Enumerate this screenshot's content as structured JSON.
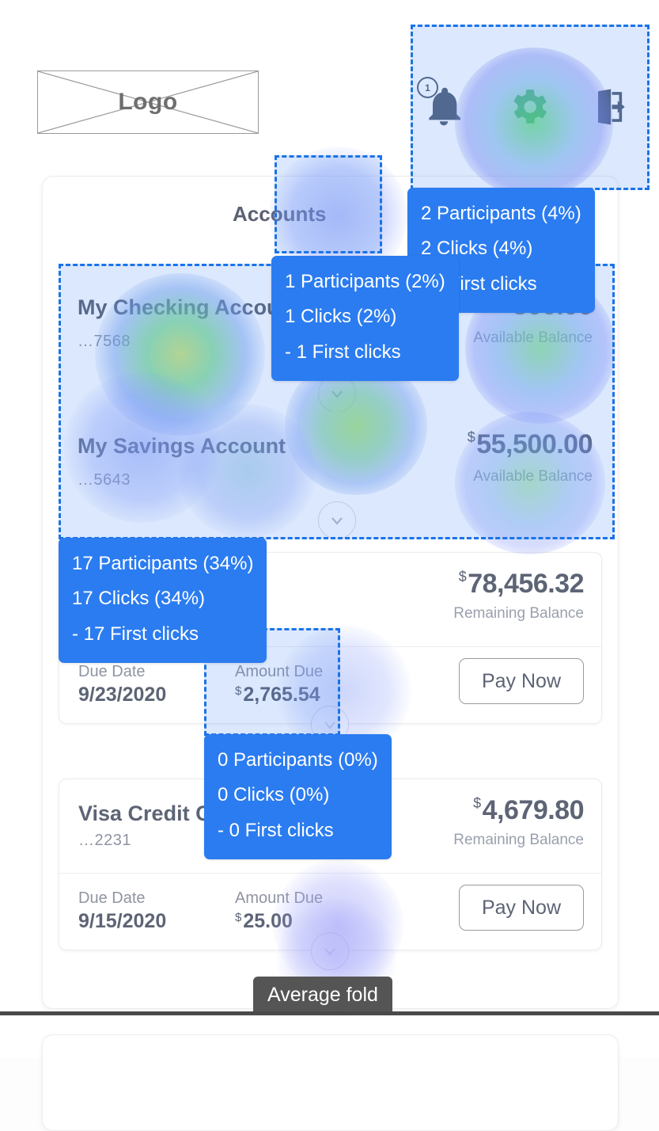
{
  "header": {
    "logo_label": "Logo",
    "icons": [
      {
        "name": "notification-bell-icon",
        "badge": "1"
      },
      {
        "name": "settings-gear-icon",
        "badge": ""
      },
      {
        "name": "logout-icon",
        "badge": ""
      }
    ]
  },
  "main": {
    "section_title": "Accounts",
    "accounts": [
      {
        "name": "My Checking Account",
        "number": "…7568",
        "currency": "$",
        "amount": "500.00",
        "sub_label": "Available Balance"
      },
      {
        "name": "My Savings Account",
        "number": "…5643",
        "currency": "$",
        "amount": "55,500.00",
        "sub_label": "Available Balance"
      }
    ],
    "cards": [
      {
        "name": "",
        "number": "",
        "currency": "$",
        "balance": "78,456.32",
        "balance_label": "Remaining Balance",
        "due_date_label": "Due Date",
        "due_date": "9/23/2020",
        "amount_due_label": "Amount Due",
        "amount_due_currency": "$",
        "amount_due": "2,765.54",
        "pay_label": "Pay Now"
      },
      {
        "name": "Visa Credit Card",
        "number": "…2231",
        "currency": "$",
        "balance": "4,679.80",
        "balance_label": "Remaining Balance",
        "due_date_label": "Due Date",
        "due_date": "9/15/2020",
        "amount_due_label": "Amount Due",
        "amount_due_currency": "$",
        "amount_due": "25.00",
        "pay_label": "Pay Now"
      }
    ]
  },
  "tooltips": [
    {
      "id": "tip-header",
      "participants": "2 Participants (4%)",
      "clicks": "2 Clicks (4%)",
      "first_clicks": "- 2 First clicks"
    },
    {
      "id": "tip-accounts",
      "participants": "1 Participants (2%)",
      "clicks": "1 Clicks (2%)",
      "first_clicks": "- 1 First clicks"
    },
    {
      "id": "tip-account-list",
      "participants": "17 Participants (34%)",
      "clicks": "17 Clicks (34%)",
      "first_clicks": "- 17 First clicks"
    },
    {
      "id": "tip-amount-due",
      "participants": "0 Participants (0%)",
      "clicks": "0 Clicks (0%)",
      "first_clicks": "- 0 First clicks"
    }
  ],
  "fold": {
    "label": "Average fold"
  },
  "colors": {
    "selection_border": "#1a73e8",
    "selection_fill": "rgba(60,130,246,0.18)",
    "tooltip_bg": "#2b7cf0",
    "fold_bg": "#555555"
  }
}
